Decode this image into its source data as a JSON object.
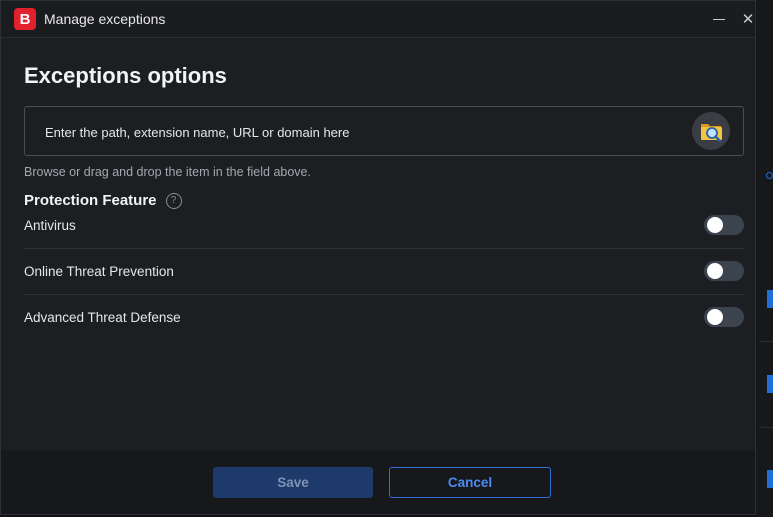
{
  "window": {
    "title": "Manage exceptions",
    "logo_letter": "B"
  },
  "main": {
    "heading": "Exceptions options",
    "path_field": {
      "placeholder": "Enter the path, extension name, URL or domain here",
      "value": "",
      "browse_icon": "folder-search-icon"
    },
    "hint": "Browse or drag and drop the item in the field above.",
    "protection": {
      "title": "Protection Feature",
      "features": [
        {
          "label": "Antivirus",
          "enabled": false
        },
        {
          "label": "Online Threat Prevention",
          "enabled": false
        },
        {
          "label": "Advanced Threat Defense",
          "enabled": false
        }
      ]
    }
  },
  "footer": {
    "save_label": "Save",
    "cancel_label": "Cancel"
  },
  "colors": {
    "brand": "#e3202e",
    "accent": "#2f6fd6",
    "background": "#1c1e22"
  }
}
